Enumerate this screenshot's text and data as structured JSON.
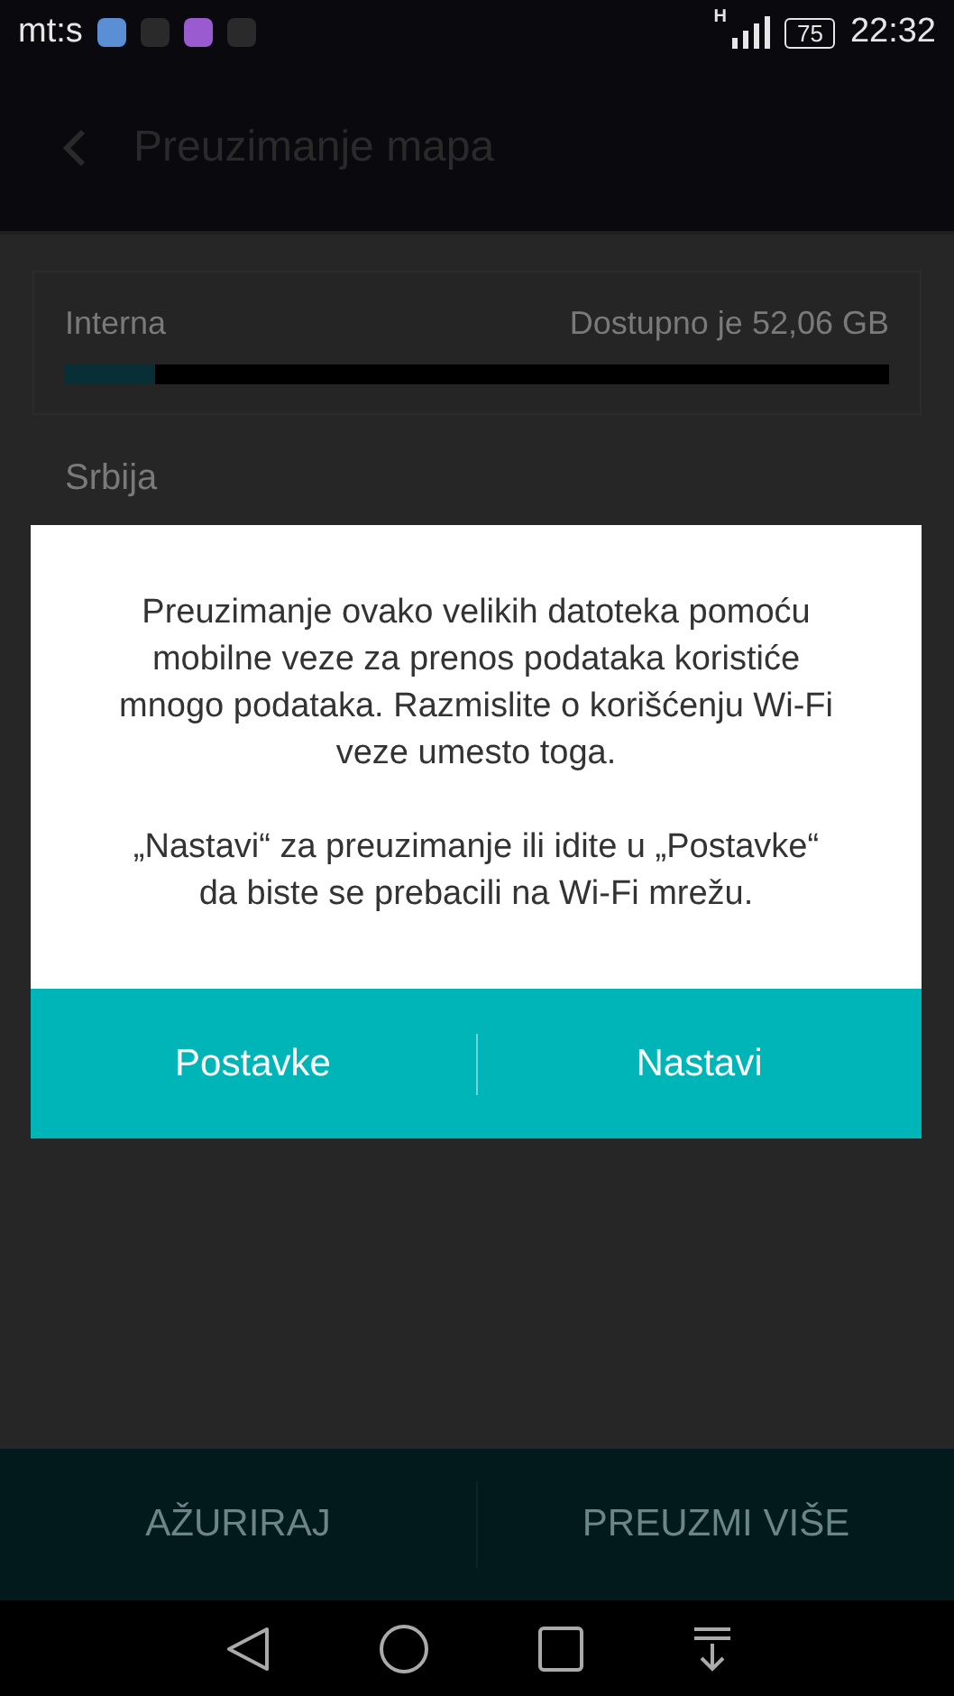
{
  "status_bar": {
    "carrier": "mt:s",
    "network": "H",
    "battery": "75",
    "time": "22:32"
  },
  "toolbar": {
    "title": "Preuzimanje mapa"
  },
  "storage": {
    "label": "Interna",
    "available": "Dostupno je 52,06 GB",
    "level": 0.11
  },
  "section": "Srbija",
  "dialog": {
    "paragraphs": [
      "Preuzimanje ovako velikih datoteka pomoću mobilne veze za prenos podataka koristiće mnogo podataka. Razmislite o korišćenju Wi-Fi veze umesto toga.",
      "„Nastavi“ za preuzimanje ili idite u „Postavke“ da biste se prebacili na Wi-Fi mrežu."
    ],
    "buttons": [
      "Postavke",
      "Nastavi"
    ]
  },
  "bottom_actions": [
    "AŽURIRAJ",
    "PREUZMI VIŠE"
  ]
}
